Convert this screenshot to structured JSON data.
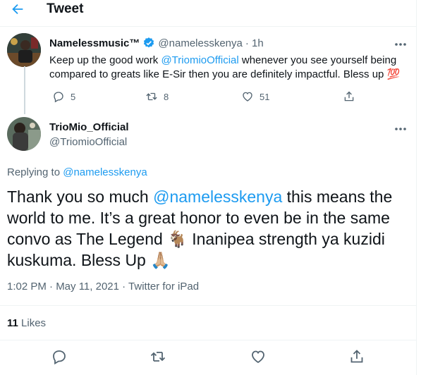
{
  "header": {
    "title": "Tweet"
  },
  "tweet1": {
    "name": "Namelessmusic™",
    "handle": "@namelesskenya",
    "time": "· 1h",
    "text_before": "Keep up the good work ",
    "mention": "@TriomioOfficial",
    "text_after": " whenever you see yourself being compared to greats like E-Sir then you are definitely impactful. Bless up ",
    "emoji": "💯",
    "replies": "5",
    "retweets": "8",
    "likes": "51"
  },
  "tweet2": {
    "name": "TrioMio_Official",
    "handle": "@TriomioOfficial",
    "replying_prefix": "Replying to ",
    "replying_handle": "@namelesskenya",
    "text_part1": "Thank you so much ",
    "mention": "@namelesskenya",
    "text_part2": " this means the world to me. It’s a great honor to even be in the same convo as The Legend ",
    "emoji_goat": "🐐",
    "text_part3": " Inanipea strength ya kuzidi kuskuma. Bless Up ",
    "emoji_pray": "🙏🏼",
    "meta": "1:02 PM · May 11, 2021 · Twitter for iPad",
    "likes_count": "11",
    "likes_label": "Likes"
  },
  "colors": {
    "accent": "#1d9bf0",
    "text": "#0f1419",
    "muted": "#536471",
    "rule": "#eff3f4"
  },
  "icons": [
    "back-arrow-icon",
    "verified-badge-icon",
    "more-icon",
    "reply-icon",
    "retweet-icon",
    "like-icon",
    "share-icon"
  ]
}
